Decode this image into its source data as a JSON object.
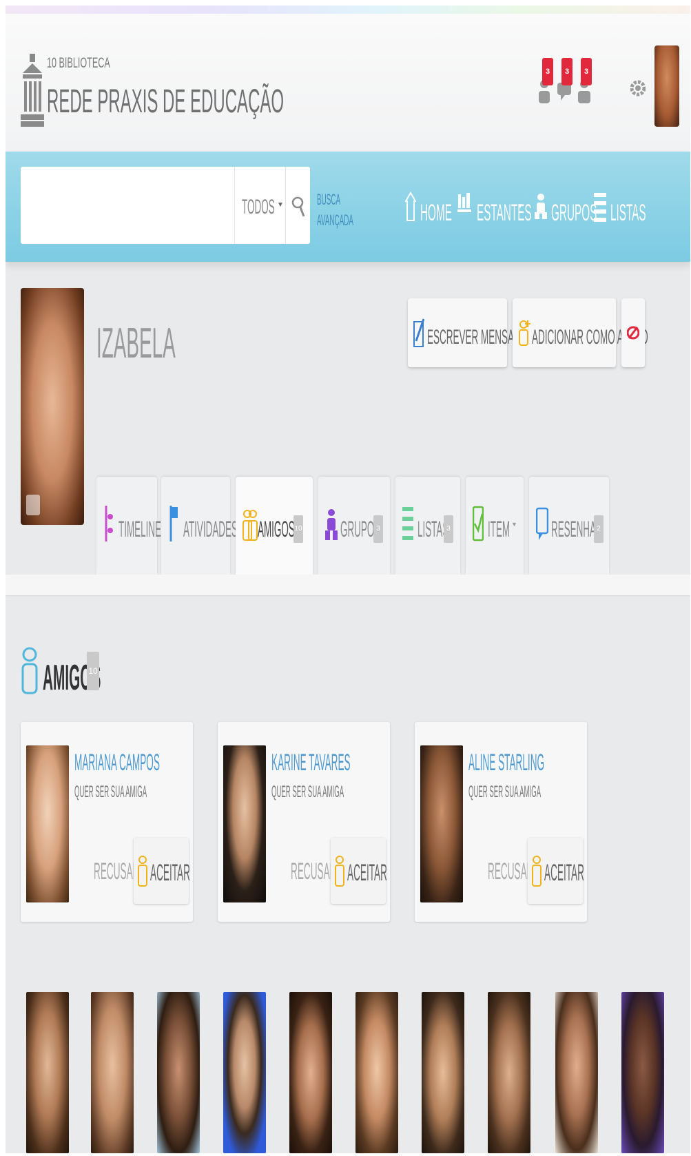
{
  "header": {
    "logo_line1": "10 BIBLIOTECA",
    "logo_line2": "REDE PRAXIS DE EDUCAÇÃO",
    "notifications": [
      {
        "icon": "friend-request-icon",
        "count": "3"
      },
      {
        "icon": "chat-icon",
        "count": "3"
      },
      {
        "icon": "group-icon",
        "count": "3"
      }
    ],
    "settings_icon": "gear-icon"
  },
  "navbar": {
    "search_placeholder": "",
    "search_scope": "TODOS",
    "advanced_search_line1": "BUSCA",
    "advanced_search_line2": "AVANÇADA",
    "items": [
      {
        "label": "HOME",
        "icon": "home-icon"
      },
      {
        "label": "ESTANTES",
        "icon": "bookshelf-icon"
      },
      {
        "label": "GRUPOS",
        "icon": "group-icon"
      },
      {
        "label": "LISTAS",
        "icon": "list-icon"
      }
    ]
  },
  "profile": {
    "name": "IZABELA",
    "actions": {
      "message": "ESCREVER MENSAGEM",
      "add_friend": "ADICIONAR COMO AMIGO"
    }
  },
  "tabs": [
    {
      "label": "TIMELINE",
      "count": null,
      "active": false
    },
    {
      "label": "ATIVIDADES",
      "count": null,
      "active": false
    },
    {
      "label": "AMIGOS",
      "count": "10",
      "active": true
    },
    {
      "label": "GRUPOS",
      "count": "3",
      "active": false
    },
    {
      "label": "LISTAS",
      "count": "3",
      "active": false
    },
    {
      "label": "ITEM",
      "count": null,
      "active": false
    },
    {
      "label": "RESENHAS",
      "count": "2",
      "active": false
    }
  ],
  "friends": {
    "title": "AMIGOS",
    "count": "10",
    "requests": [
      {
        "name": "MARIANA CAMPOS",
        "message": "QUER SER SUA AMIGA",
        "refuse": "RECUSAR",
        "accept": "ACEITAR"
      },
      {
        "name": "KARINE TAVARES",
        "message": "QUER SER SUA AMIGA",
        "refuse": "RECUSAR",
        "accept": "ACEITAR"
      },
      {
        "name": "ALINE STARLING",
        "message": "QUER SER SUA AMIGA",
        "refuse": "RECUSAR",
        "accept": "ACEITAR"
      }
    ]
  },
  "colors": {
    "accent": "#7ccbe3",
    "badge": "#e2283c",
    "link": "#4e9ad0",
    "accept_icon": "#f2b21b"
  }
}
